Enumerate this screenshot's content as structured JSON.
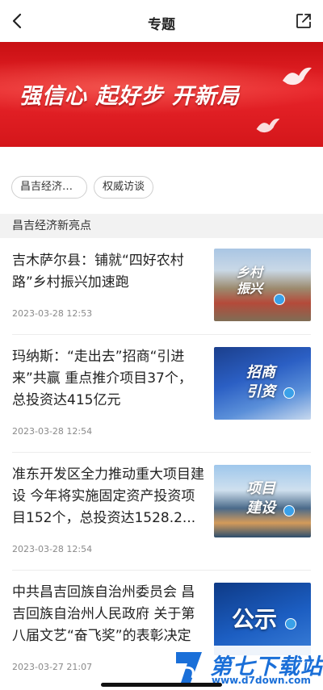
{
  "header": {
    "title": "专题",
    "back_icon": "chevron-left-icon",
    "share_icon": "share-icon"
  },
  "banner": {
    "slogan": "强信心  起好步  开新局"
  },
  "chips": [
    "昌吉经济新...",
    "权威访谈"
  ],
  "section_title": "昌吉经济新亮点",
  "articles": [
    {
      "title": "吉木萨尔县：铺就“四好农村路”乡村振兴加速跑",
      "date": "2023-03-28 12:53",
      "thumb_text": "乡村振兴"
    },
    {
      "title": "玛纳斯：“走出去”招商“引进来”共赢 重点推介项目37个，总投资达415亿元",
      "date": "2023-03-28 12:54",
      "thumb_text": "招商引资"
    },
    {
      "title": "准东开发区全力推动重大项目建设 今年将实施固定资产投资项目152个，总投资达1528.2...",
      "date": "2023-03-28 12:54",
      "thumb_text": "项目建设"
    },
    {
      "title": "中共昌吉回族自治州委员会 昌吉回族自治州人民政府 关于第八届文艺“奋飞奖”的表彰决定",
      "date": "2023-03-27 21:07",
      "thumb_text": "公示"
    }
  ],
  "watermark": {
    "name": "第七下载站",
    "url": "www.d7down.com"
  },
  "colors": {
    "accent": "#e8242a",
    "watermark": "#1a6fd8"
  }
}
